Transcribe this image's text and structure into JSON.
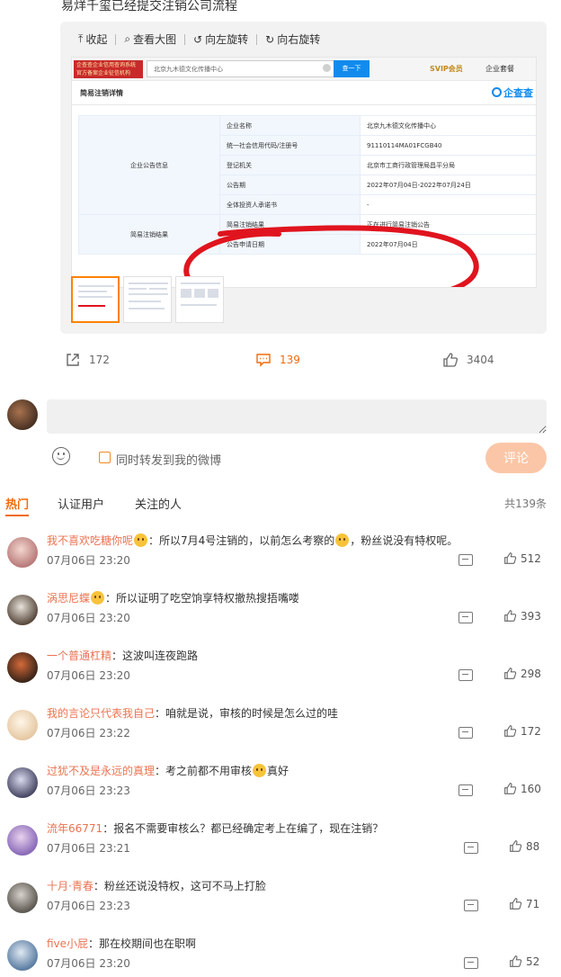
{
  "post": {
    "text": "易烊千玺已经提交注销公司流程"
  },
  "media": {
    "toolbar": [
      {
        "icon": "collapse-icon",
        "glyph": "⤒",
        "label": "收起"
      },
      {
        "icon": "zoom-icon",
        "glyph": "⌕",
        "label": "查看大图"
      },
      {
        "icon": "rotate-left-icon",
        "glyph": "↺",
        "label": "向左旋转"
      },
      {
        "icon": "rotate-right-icon",
        "glyph": "↻",
        "label": "向右旋转"
      }
    ],
    "screenshot": {
      "logo_text": "企查查企业信用查询系统 官方备案企业征信机构",
      "search_value": "北京九木德文化传播中心",
      "search_button": "查一下",
      "svip": "SVIP会员",
      "firm_link": "企业套餐",
      "section_title": "简易注销详情",
      "brand": "企查查",
      "groups": [
        {
          "name": "企业公告信息",
          "rows": [
            {
              "label": "企业名称",
              "value": "北京九木德文化传播中心"
            },
            {
              "label": "统一社会信用代码/注册号",
              "value": "91110114MA01FCGB40"
            },
            {
              "label": "登记机关",
              "value": "北京市工商行政管理局昌平分局"
            },
            {
              "label": "公告期",
              "value": "2022年07月04日-2022年07月24日"
            },
            {
              "label": "全体投资人承诺书",
              "value": "-"
            }
          ]
        },
        {
          "name": "简易注销结果",
          "rows": [
            {
              "label": "简易注销结果",
              "value": "正在进行简易注销公告"
            },
            {
              "label": "公告申请日期",
              "value": "2022年07月04日"
            }
          ]
        }
      ]
    }
  },
  "actions": {
    "forward_count": "172",
    "comment_count": "139",
    "like_count": "3404"
  },
  "composer": {
    "placeholder": "",
    "forward_label": "同时转发到我的微博",
    "submit_label": "评论"
  },
  "sort": {
    "tabs": [
      "热门",
      "认证用户",
      "关注的人"
    ],
    "total": "共139条"
  },
  "comments": [
    {
      "user": "我不喜欢吃糖你呢",
      "text_a": "：所以7月4号注销的，以前怎么考察的",
      "text_b": "，粉丝说没有特权呢。",
      "time": "07月06日 23:20",
      "likes": "512"
    },
    {
      "user": "涡思尼蝶",
      "text_a": "：所以证明了吃空饷享特权撤热搜捂嘴喽",
      "text_b": "",
      "time": "07月06日 23:20",
      "likes": "393"
    },
    {
      "user": "一个普通杠精",
      "text_a": "：这波叫连夜跑路",
      "text_b": "",
      "time": "07月06日 23:20",
      "likes": "298"
    },
    {
      "user": "我的言论只代表我自己",
      "text_a": "：咱就是说，审核的时候是怎么过的哇",
      "text_b": "",
      "time": "07月06日 23:22",
      "likes": "172"
    },
    {
      "user": "过犹不及是永远的真理",
      "text_a": "：考之前都不用审核",
      "text_b": "真好",
      "time": "07月06日 23:23",
      "likes": "160"
    },
    {
      "user": "流年66771",
      "text_a": "：报名不需要审核么？都已经确定考上在编了，现在注销？",
      "text_b": "",
      "time": "07月06日 23:21",
      "likes": "88"
    },
    {
      "user": "十月·青春",
      "text_a": "：粉丝还说没特权，这可不马上打脸",
      "text_b": "",
      "time": "07月06日 23:23",
      "likes": "71"
    },
    {
      "user": "five小屁",
      "text_a": "：那在校期间也在职啊",
      "text_b": "",
      "time": "07月06日 23:20",
      "likes": "52"
    }
  ],
  "colors": {
    "accent": "#eb7350",
    "tab_active": "#f06b0c",
    "submit_bg": "#fbc6a7",
    "red_mark": "#e0141e"
  }
}
